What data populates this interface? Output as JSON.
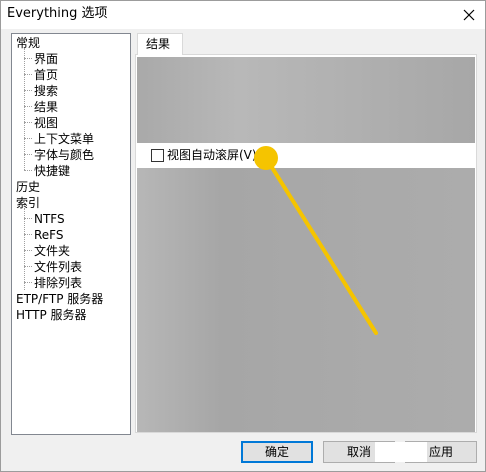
{
  "window": {
    "title": "Everything 选项",
    "close_icon": "close-icon"
  },
  "tree": {
    "items": [
      {
        "label": "常规",
        "level": 0
      },
      {
        "label": "界面",
        "level": 1
      },
      {
        "label": "首页",
        "level": 1
      },
      {
        "label": "搜索",
        "level": 1
      },
      {
        "label": "结果",
        "level": 1
      },
      {
        "label": "视图",
        "level": 1
      },
      {
        "label": "上下文菜单",
        "level": 1
      },
      {
        "label": "字体与颜色",
        "level": 1
      },
      {
        "label": "快捷键",
        "level": 1
      },
      {
        "label": "历史",
        "level": 0
      },
      {
        "label": "索引",
        "level": 0
      },
      {
        "label": "NTFS",
        "level": 1
      },
      {
        "label": "ReFS",
        "level": 1
      },
      {
        "label": "文件夹",
        "level": 1
      },
      {
        "label": "文件列表",
        "level": 1
      },
      {
        "label": "排除列表",
        "level": 1
      },
      {
        "label": "ETP/FTP 服务器",
        "level": 0
      },
      {
        "label": "HTTP 服务器",
        "level": 0
      }
    ]
  },
  "tab": {
    "label": "结果"
  },
  "options": {
    "auto_scroll_label": "视图自动滚屏(V)",
    "auto_scroll_checked": false
  },
  "buttons": {
    "ok": "确定",
    "cancel": "取消",
    "apply": "应用"
  },
  "colors": {
    "annotation": "#f5c400",
    "primary_border": "#0078d7"
  }
}
